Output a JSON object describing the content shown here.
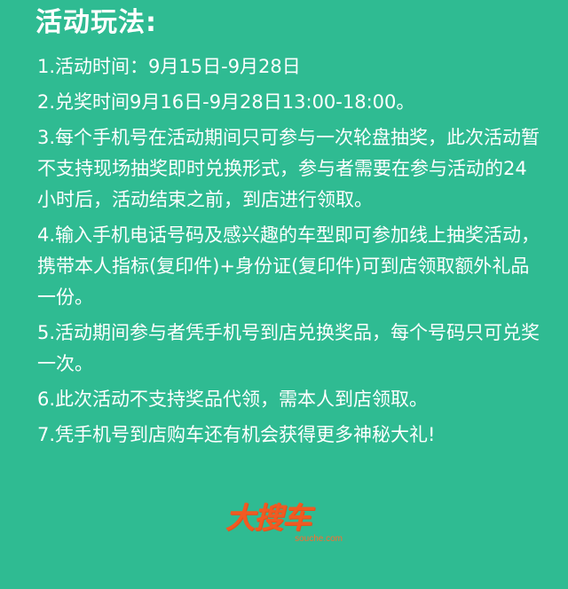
{
  "title": "活动玩法:",
  "rules": [
    "1.活动时间：9月15日-9月28日",
    "2.兑奖时间9月16日-9月28日13:00-18:00。",
    "3.每个手机号在活动期间只可参与一次轮盘抽奖，此次活动暂不支持现场抽奖即时兑换形式，参与者需要在参与活动的24小时后，活动结束之前，到店进行领取。",
    "4.输入手机电话号码及感兴趣的车型即可参加线上抽奖活动，携带本人指标(复印件)+身份证(复印件)可到店领取额外礼品一份。",
    "5.活动期间参与者凭手机号到店兑换奖品，每个号码只可兑奖一次。",
    "6.此次活动不支持奖品代领，需本人到店领取。",
    "7.凭手机号到店购车还有机会获得更多神秘大礼!"
  ],
  "logo": {
    "brand": "大搜车",
    "domain": "souche.com",
    "color": "#f15a22"
  },
  "colors": {
    "background": "#2fbb92",
    "text": "#ffffff"
  }
}
